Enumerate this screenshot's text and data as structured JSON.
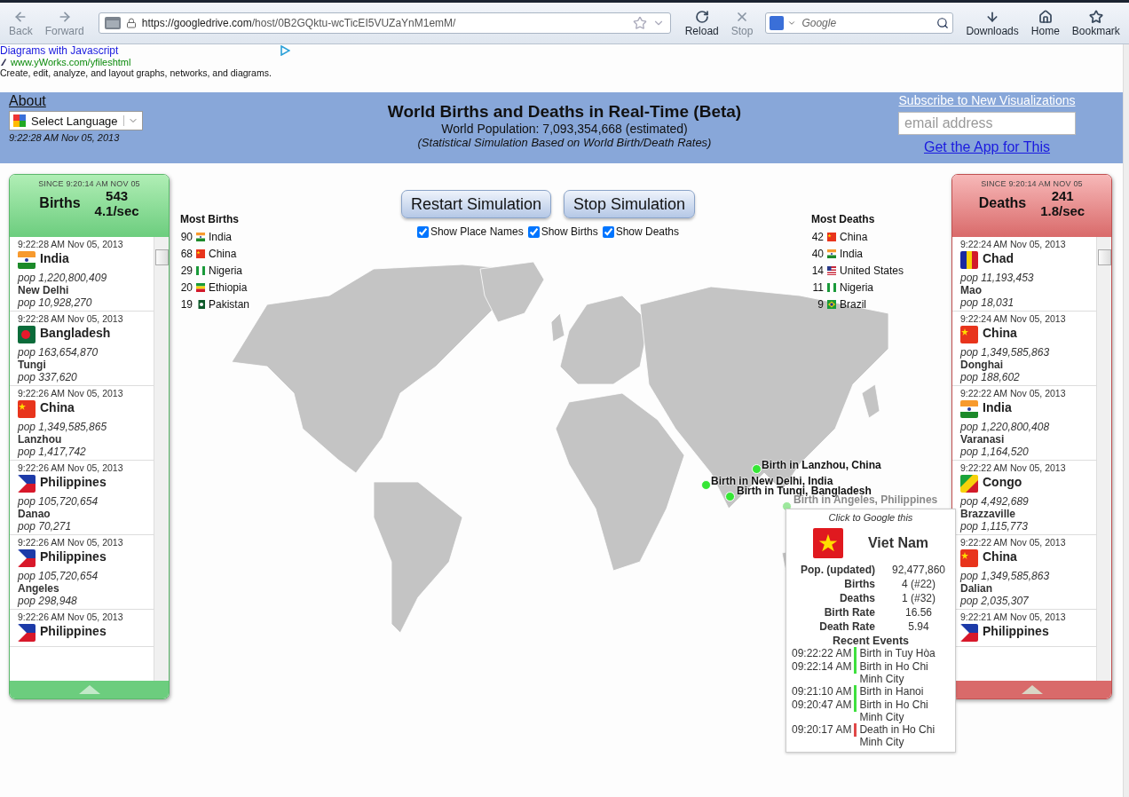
{
  "browser": {
    "nav": [
      {
        "label": "Back",
        "kind": "back"
      },
      {
        "label": "Forward",
        "kind": "forward"
      }
    ],
    "url": {
      "host": "https://googledrive.com",
      "path": "/host/0B2GQktu-wcTicEI5VUZaYnM1emM/"
    },
    "actions": [
      {
        "label": "Reload",
        "kind": "reload"
      },
      {
        "label": "Stop",
        "kind": "stop"
      }
    ],
    "search_placeholder": "Google",
    "tools": [
      {
        "label": "Downloads",
        "kind": "downloads"
      },
      {
        "label": "Home",
        "kind": "home"
      },
      {
        "label": "Bookmark",
        "kind": "bookmark"
      }
    ]
  },
  "ad": {
    "title": "Diagrams with Javascript",
    "url": "www.yWorks.com/yfileshtml",
    "text": "Create, edit, analyze, and layout graphs, networks, and diagrams."
  },
  "header": {
    "about": "About",
    "language": "Select Language",
    "time": "9:22:28 AM Nov 05, 2013",
    "title": "World Births and Deaths in Real-Time (Beta)",
    "population": "World Population: 7,093,354,668 (estimated)",
    "subtitle": "(Statistical Simulation Based on World Birth/Death Rates)",
    "subscribe": "Subscribe to New Visualizations",
    "email_placeholder": "email address",
    "app_link": "Get the App for This"
  },
  "panels": [
    {
      "kind": "births",
      "since": "SINCE 9:20:14 AM NOV 05",
      "label": "Births",
      "count": "543",
      "rate": "4.1/sec",
      "events": [
        {
          "time": "9:22:28 AM Nov 05, 2013",
          "kind": "india",
          "country": "India",
          "country_pop": "pop 1,220,800,409",
          "city": "New Delhi",
          "city_pop": "pop 10,928,270"
        },
        {
          "time": "9:22:28 AM Nov 05, 2013",
          "kind": "bangladesh",
          "country": "Bangladesh",
          "country_pop": "pop 163,654,870",
          "city": "Tungi",
          "city_pop": "pop 337,620"
        },
        {
          "time": "9:22:26 AM Nov 05, 2013",
          "kind": "china",
          "country": "China",
          "country_pop": "pop 1,349,585,865",
          "city": "Lanzhou",
          "city_pop": "pop 1,417,742"
        },
        {
          "time": "9:22:26 AM Nov 05, 2013",
          "kind": "philippines",
          "country": "Philippines",
          "country_pop": "pop 105,720,654",
          "city": "Danao",
          "city_pop": "pop 70,271"
        },
        {
          "time": "9:22:26 AM Nov 05, 2013",
          "kind": "philippines",
          "country": "Philippines",
          "country_pop": "pop 105,720,654",
          "city": "Angeles",
          "city_pop": "pop 298,948"
        },
        {
          "time": "9:22:26 AM Nov 05, 2013",
          "kind": "philippines",
          "country": "Philippines"
        }
      ]
    },
    {
      "kind": "deaths",
      "since": "SINCE 9:20:14 AM NOV 05",
      "label": "Deaths",
      "count": "241",
      "rate": "1.8/sec",
      "events": [
        {
          "time": "9:22:24 AM Nov 05, 2013",
          "kind": "chad",
          "country": "Chad",
          "country_pop": "pop 11,193,453",
          "city": "Mao",
          "city_pop": "pop 18,031"
        },
        {
          "time": "9:22:24 AM Nov 05, 2013",
          "kind": "china",
          "country": "China",
          "country_pop": "pop 1,349,585,863",
          "city": "Donghai",
          "city_pop": "pop 188,602"
        },
        {
          "time": "9:22:22 AM Nov 05, 2013",
          "kind": "india",
          "country": "India",
          "country_pop": "pop 1,220,800,408",
          "city": "Varanasi",
          "city_pop": "pop 1,164,520"
        },
        {
          "time": "9:22:22 AM Nov 05, 2013",
          "kind": "congo",
          "country": "Congo",
          "country_pop": "pop 4,492,689",
          "city": "Brazzaville",
          "city_pop": "pop 1,115,773"
        },
        {
          "time": "9:22:22 AM Nov 05, 2013",
          "kind": "china",
          "country": "China",
          "country_pop": "pop 1,349,585,863",
          "city": "Dalian",
          "city_pop": "pop 2,035,307"
        },
        {
          "time": "9:22:21 AM Nov 05, 2013",
          "kind": "philippines",
          "country": "Philippines"
        }
      ]
    }
  ],
  "most_births": {
    "title": "Most Births",
    "items": [
      {
        "count": "90",
        "kind": "india",
        "country": "India"
      },
      {
        "count": "68",
        "kind": "china",
        "country": "China"
      },
      {
        "count": "29",
        "kind": "nigeria",
        "country": "Nigeria"
      },
      {
        "count": "20",
        "kind": "ethiopia",
        "country": "Ethiopia"
      },
      {
        "count": "19",
        "kind": "pakistan",
        "country": "Pakistan"
      }
    ]
  },
  "controls": {
    "buttons": [
      "Restart Simulation",
      "Stop Simulation"
    ],
    "checkboxes": [
      {
        "label": "Show Place Names",
        "checked": true
      },
      {
        "label": "Show Births",
        "checked": true
      },
      {
        "label": "Show Deaths",
        "checked": true
      }
    ]
  },
  "most_deaths": {
    "title": "Most Deaths",
    "items": [
      {
        "count": "42",
        "kind": "china",
        "country": "China"
      },
      {
        "count": "40",
        "kind": "india",
        "country": "India"
      },
      {
        "count": "14",
        "kind": "usa",
        "country": "United States"
      },
      {
        "count": "11",
        "kind": "nigeria",
        "country": "Nigeria"
      },
      {
        "count": "9",
        "kind": "brazil",
        "country": "Brazil"
      }
    ]
  },
  "map_markers": [
    {
      "label": "Birth in Lanzhou, China",
      "faded": false
    },
    {
      "label": "Birth in New Delhi, India",
      "faded": false
    },
    {
      "label": "Birth in Tungi, Bangladesh",
      "faded": false
    },
    {
      "label": "Birth in Angeles, Philippines",
      "faded": true
    }
  ],
  "popup": {
    "hint": "Click to Google this",
    "kind": "vietnam",
    "country": "Viet Nam",
    "stats": [
      {
        "label": "Pop. (updated)",
        "value": "92,477,860"
      },
      {
        "label": "Births",
        "value": "4 (#22)"
      },
      {
        "label": "Deaths",
        "value": "1 (#32)"
      },
      {
        "label": "Birth Rate",
        "value": "16.56"
      },
      {
        "label": "Death Rate",
        "value": "5.94"
      }
    ],
    "events_title": "Recent Events",
    "events": [
      {
        "time": "09:22:22 AM",
        "kind": "birth",
        "text": "Birth in Tuy Hòa"
      },
      {
        "time": "09:22:14 AM",
        "kind": "birth",
        "text": "Birth in Ho Chi Minh City"
      },
      {
        "time": "09:21:10 AM",
        "kind": "birth",
        "text": "Birth in Hanoi"
      },
      {
        "time": "09:20:47 AM",
        "kind": "birth",
        "text": "Birth in Ho Chi Minh City"
      },
      {
        "time": "09:20:17 AM",
        "kind": "death",
        "text": "Death in Ho Chi Minh City"
      }
    ]
  }
}
